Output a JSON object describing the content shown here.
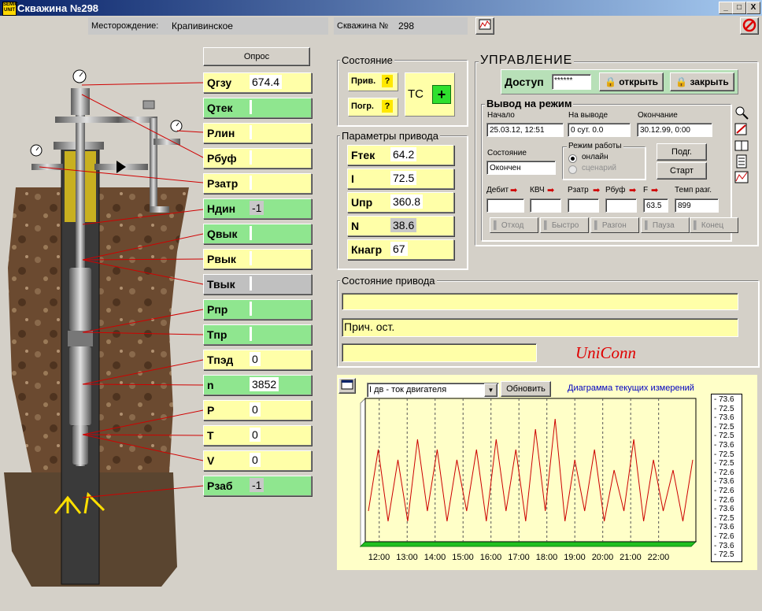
{
  "window": {
    "title": "Скважина №298",
    "app_icon_text": "SEMIC UNIT",
    "min": "_",
    "max": "□",
    "close": "X"
  },
  "header": {
    "field_label": "Месторождение:",
    "field_value": "Крапивинское",
    "well_label": "Скважина №",
    "well_value": "298"
  },
  "poll_button": "Опрос",
  "params": [
    {
      "name": "Qгзу",
      "value": "674.4",
      "color": "y"
    },
    {
      "name": "Qтек",
      "value": "",
      "color": "g"
    },
    {
      "name": "Рлин",
      "value": "",
      "color": "y"
    },
    {
      "name": "Рбуф",
      "value": "",
      "color": "y"
    },
    {
      "name": "Рзатр",
      "value": "",
      "color": "y"
    },
    {
      "name": "Ндин",
      "value": "-1",
      "color": "g"
    },
    {
      "name": "Qвык",
      "value": "",
      "color": "g"
    },
    {
      "name": "Рвык",
      "value": "",
      "color": "y"
    },
    {
      "name": "Твык",
      "value": "",
      "color": "gr"
    },
    {
      "name": "Рпр",
      "value": "",
      "color": "g"
    },
    {
      "name": "Тпр",
      "value": "",
      "color": "g"
    },
    {
      "name": "Тпэд",
      "value": "0",
      "color": "y"
    },
    {
      "name": "n",
      "value": "3852",
      "color": "g"
    },
    {
      "name": "P",
      "value": "0",
      "color": "y"
    },
    {
      "name": "T",
      "value": "0",
      "color": "y"
    },
    {
      "name": "V",
      "value": "0",
      "color": "y"
    },
    {
      "name": "Рзаб",
      "value": "-1",
      "color": "g"
    }
  ],
  "state": {
    "caption": "Состояние",
    "priv": "Прив.",
    "pogr": "Погр.",
    "q": "?",
    "tc": "ТС",
    "plus": "+"
  },
  "drive": {
    "caption": "Параметры привода",
    "items": [
      {
        "name": "Fтек",
        "value": "64.2"
      },
      {
        "name": "I",
        "value": "72.5"
      },
      {
        "name": "Uпр",
        "value": "360.8"
      },
      {
        "name": "N",
        "value": "38.6"
      },
      {
        "name": "Кнагр",
        "value": "67"
      }
    ]
  },
  "control": {
    "caption": "УПРАВЛЕНИЕ",
    "access_label": "Доступ",
    "access_value": "******",
    "open": "открыть",
    "close": "закрыть",
    "mode_caption": "Вывод на режим",
    "start_label": "Начало",
    "start_value": "25.03.12, 12:51",
    "output_label": "На выводе",
    "output_value": "0 сут. 0.0",
    "end_label": "Окончание",
    "end_value": "30.12.99, 0:00",
    "state_label": "Состояние",
    "state_value": "Окончен",
    "work_mode_caption": "Режим работы",
    "online": "онлайн",
    "scenario": "сценарий",
    "prep": "Подг.",
    "start": "Старт",
    "metrics": [
      {
        "label": "Дебит",
        "value": ""
      },
      {
        "label": "КВЧ",
        "value": ""
      },
      {
        "label": "Рзатр",
        "value": ""
      },
      {
        "label": "Рбуф",
        "value": ""
      },
      {
        "label": "F",
        "value": "63.5"
      },
      {
        "label": "Темп разг.",
        "value": "899"
      }
    ],
    "toolbar": [
      "Отход",
      "Быстро",
      "Разгон",
      "Пауза",
      "Конец"
    ]
  },
  "drive_state": {
    "caption": "Состояние привода",
    "stop_reason": "Прич. ост.",
    "brand": "UniConn"
  },
  "chart_header": {
    "select_value": "I дв - ток двигателя",
    "refresh": "Обновить",
    "title": "Диаграмма текущих измерений"
  },
  "colors": {
    "yellow": "#ffffa8",
    "green": "#8fe68f",
    "trace": "#cc0000",
    "plot_bg": "#ffffc8"
  },
  "chart_data": {
    "type": "line",
    "title": "Диаграмма текущих измерений",
    "series": [
      {
        "values": [
          72.6,
          73.2,
          72.5,
          73.1,
          72.5,
          73.3,
          72.6,
          73.2,
          72.5,
          73.1,
          72.6,
          73.2,
          72.5,
          73.3,
          72.6,
          73.2,
          72.5,
          73.4,
          72.6,
          73.5,
          72.5,
          73.1,
          72.6,
          73.2,
          72.5,
          73.0,
          72.6,
          73.3,
          72.5,
          73.1,
          72.6,
          73.0,
          72.5,
          73.1
        ]
      }
    ],
    "x_range": [
      "11:30",
      "23:20"
    ],
    "x_ticks": [
      "12:00",
      "13:00",
      "14:00",
      "15:00",
      "16:00",
      "17:00",
      "18:00",
      "19:00",
      "20:00",
      "21:00",
      "22:00"
    ],
    "y_ticks": [
      "73.6",
      "72.5",
      "73.6",
      "72.5",
      "72.5",
      "73.6",
      "72.5",
      "72.5",
      "72.6",
      "73.6",
      "72.6",
      "72.6",
      "73.6",
      "72.5",
      "73.6",
      "72.6",
      "73.6",
      "72.5"
    ],
    "grid": true,
    "legend": "none"
  }
}
